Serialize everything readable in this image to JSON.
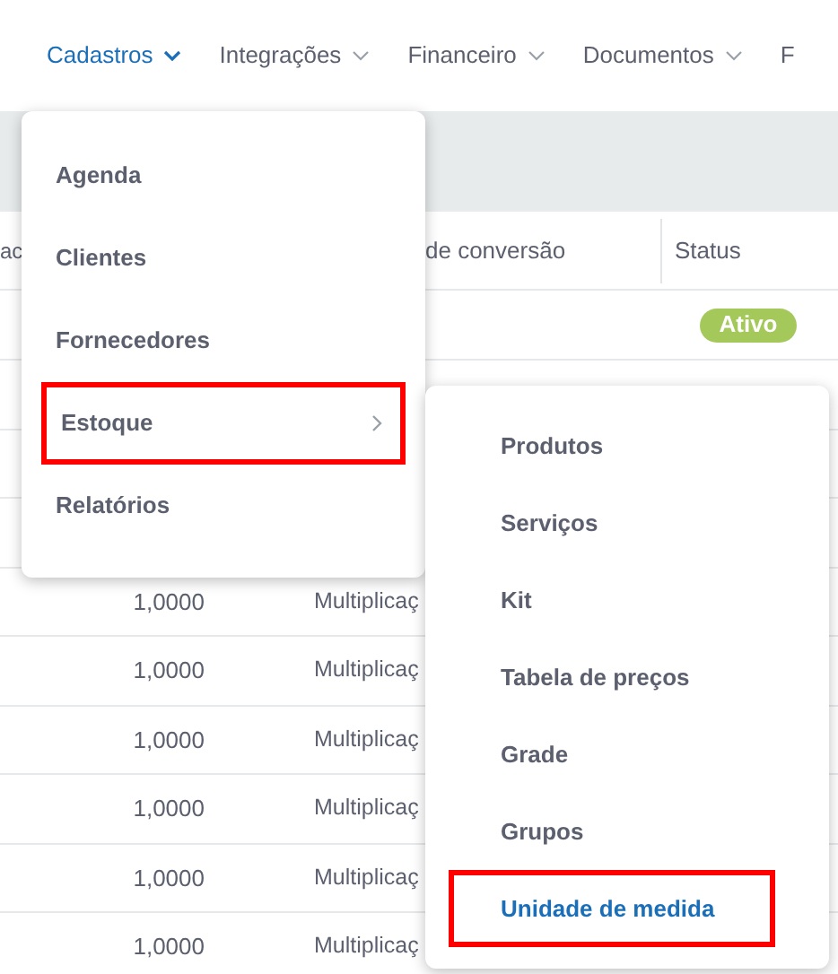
{
  "nav": {
    "items": [
      {
        "label": "Cadastros",
        "selected": true,
        "caret": true
      },
      {
        "label": "Integrações",
        "selected": false,
        "caret": true
      },
      {
        "label": "Financeiro",
        "selected": false,
        "caret": true
      },
      {
        "label": "Documentos",
        "selected": false,
        "caret": true
      },
      {
        "label": "F",
        "selected": false,
        "caret": false
      }
    ]
  },
  "table": {
    "columns": [
      {
        "label": "ac"
      },
      {
        "label": "de conversão"
      },
      {
        "label": "Status"
      }
    ],
    "top_rows": [
      {
        "status": "Ativo"
      }
    ],
    "rows": [
      {
        "column_1": "1,0000",
        "column_2": "Multiplicaç"
      },
      {
        "column_1": "1,0000",
        "column_2": "Multiplicaç"
      },
      {
        "column_1": "1,0000",
        "column_2": "Multiplicaç"
      },
      {
        "column_1": "1,0000",
        "column_2": "Multiplicaç"
      },
      {
        "column_1": "1,0000",
        "column_2": "Multiplicaç"
      },
      {
        "column_1": "1,0000",
        "column_2": "Multiplicaç"
      }
    ]
  },
  "menu": {
    "items": [
      {
        "label": "Agenda",
        "highlighted": false,
        "submenu": false
      },
      {
        "label": "Clientes",
        "highlighted": false,
        "submenu": false
      },
      {
        "label": "Fornecedores",
        "highlighted": false,
        "submenu": false
      },
      {
        "label": "Estoque",
        "highlighted": true,
        "submenu": true
      },
      {
        "label": "Relatórios",
        "highlighted": false,
        "submenu": false
      }
    ]
  },
  "submenu": {
    "items": [
      {
        "label": "Produtos",
        "selected": false,
        "highlighted": false
      },
      {
        "label": "Serviços",
        "selected": false,
        "highlighted": false
      },
      {
        "label": "Kit",
        "selected": false,
        "highlighted": false
      },
      {
        "label": "Tabela de preços",
        "selected": false,
        "highlighted": false
      },
      {
        "label": "Grade",
        "selected": false,
        "highlighted": false
      },
      {
        "label": "Grupos",
        "selected": false,
        "highlighted": false
      },
      {
        "label": "Unidade de medida",
        "selected": true,
        "highlighted": true
      }
    ]
  }
}
